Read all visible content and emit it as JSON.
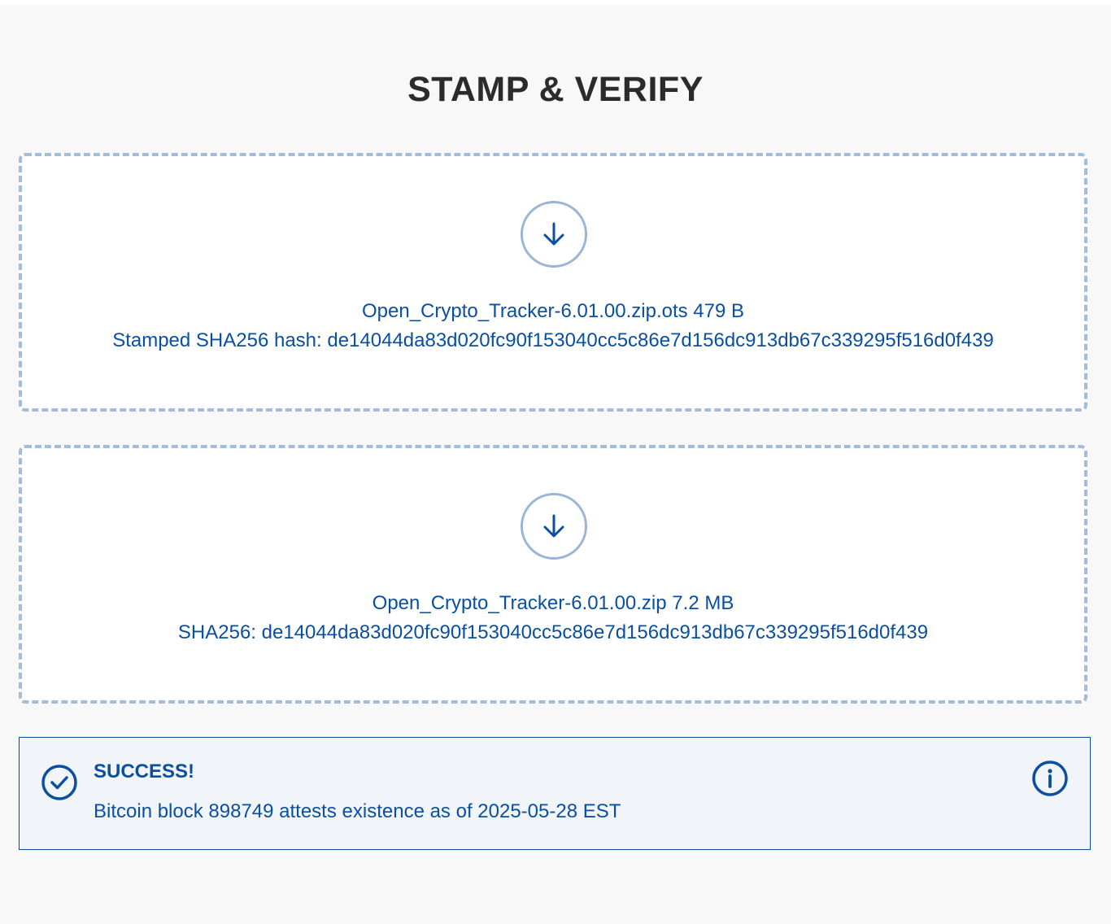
{
  "page": {
    "title": "STAMP & VERIFY"
  },
  "ots_zone": {
    "icon": "download-arrow-icon",
    "filename": "Open_Crypto_Tracker-6.01.00.zip.ots",
    "size": "479 B",
    "hash_label": "Stamped SHA256 hash:",
    "hash": "de14044da83d020fc90f153040cc5c86e7d156dc913db67c339295f516d0f439"
  },
  "file_zone": {
    "icon": "download-arrow-icon",
    "filename": "Open_Crypto_Tracker-6.01.00.zip",
    "size": "7.2 MB",
    "hash_label": "SHA256:",
    "hash": "de14044da83d020fc90f153040cc5c86e7d156dc913db67c339295f516d0f439"
  },
  "result": {
    "icon": "check-circle-icon",
    "info_icon": "info-icon",
    "title": "SUCCESS!",
    "message": "Bitcoin block 898749 attests existence as of 2025-05-28 EST"
  },
  "colors": {
    "accent": "#0a4fa0",
    "dashed_border": "#a3bdd9",
    "alert_background": "#f1f5fa",
    "title_text": "#2b2b2b"
  }
}
